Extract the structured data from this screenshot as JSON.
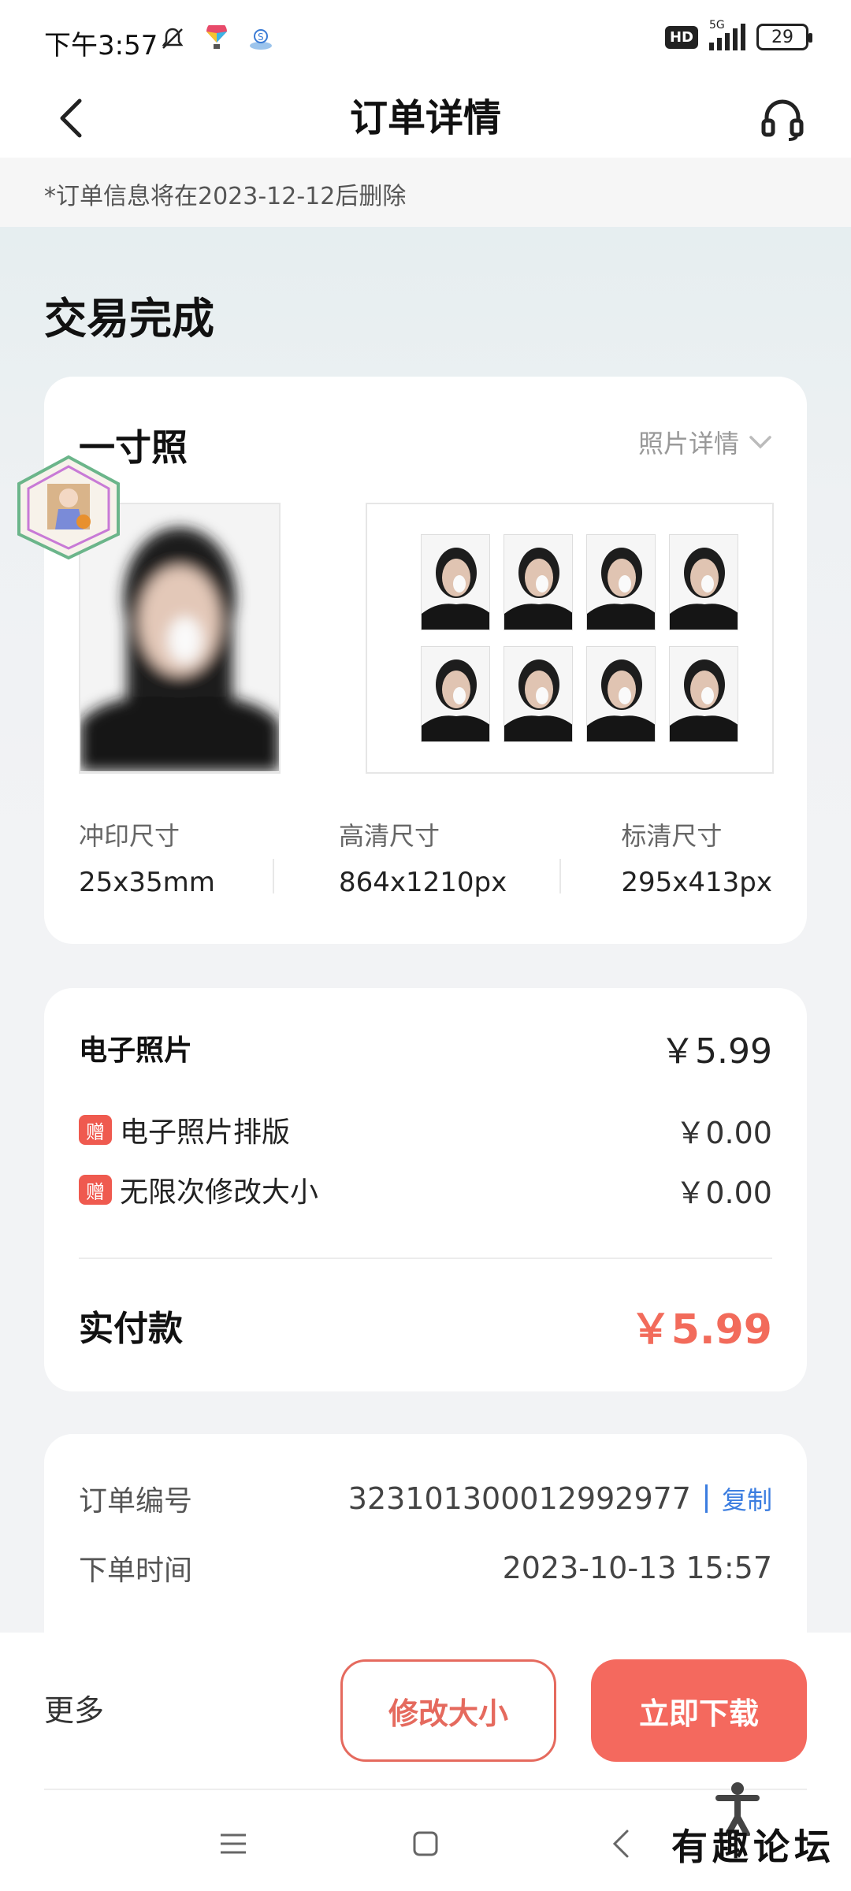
{
  "status_bar": {
    "time": "下午3:57",
    "network": "5G",
    "hd": "HD",
    "battery": "29"
  },
  "header": {
    "title": "订单详情"
  },
  "notice": {
    "text": "*订单信息将在2023-12-12后删除"
  },
  "order_status": "交易完成",
  "photo_card": {
    "type": "一寸照",
    "detail_link": "照片详情",
    "specs": [
      {
        "label": "冲印尺寸",
        "value": "25x35mm"
      },
      {
        "label": "高清尺寸",
        "value": "864x1210px"
      },
      {
        "label": "标清尺寸",
        "value": "295x413px"
      }
    ]
  },
  "price_card": {
    "item_label": "电子照片",
    "item_price": "￥5.99",
    "gifts": [
      {
        "badge": "赠",
        "label": "电子照片排版",
        "price": "￥0.00"
      },
      {
        "badge": "赠",
        "label": "无限次修改大小",
        "price": "￥0.00"
      }
    ],
    "total_label": "实付款",
    "total_price": "￥5.99"
  },
  "order_card": {
    "number_label": "订单编号",
    "number_value": "323101300012992977",
    "copy_label": "复制",
    "time_label": "下单时间",
    "time_value": "2023-10-13 15:57"
  },
  "bottom_bar": {
    "more_label": "更多",
    "resize_label": "修改大小",
    "download_label": "立即下载"
  },
  "watermark": "有趣论坛",
  "colors": {
    "accent": "#f4695e",
    "link": "#3b7de0",
    "gift_badge": "#ef5a4f"
  }
}
